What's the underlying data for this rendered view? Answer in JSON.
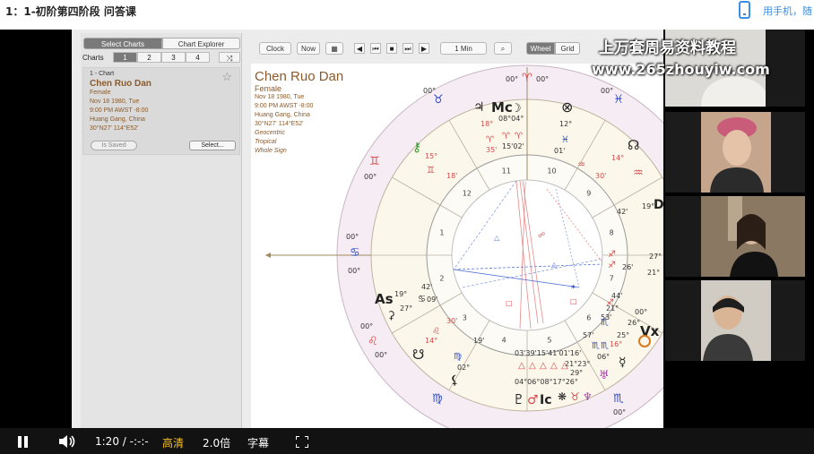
{
  "header": {
    "lesson_title": "1：1-初阶第四阶段 问答课",
    "phone_link": "用手机，随"
  },
  "watermark": {
    "line1": "上万套周易资料教程",
    "line2": "www.265zhouyiw.com"
  },
  "sidebar": {
    "seg_select": "Select Charts",
    "seg_explorer": "Chart Explorer",
    "charts_label": "Charts",
    "chart_tabs": [
      "1",
      "2",
      "3",
      "4"
    ],
    "card": {
      "number": "1 - Chart",
      "name": "Chen Ruo Dan",
      "gender": "Female",
      "date": "Nov 18 1980, Tue",
      "time": "9:00 PM AWST -8:00",
      "place": "Huang Gang, China",
      "coords": "30°N27' 114°E52'",
      "saved_label": "Is Saved",
      "select_label": "Select..."
    }
  },
  "toolbar": {
    "clock": "Clock",
    "now": "Now",
    "interval": "1 Min",
    "wheel": "Wheel",
    "grid": "Grid"
  },
  "chart_info": {
    "name": "Chen Ruo Dan",
    "gender": "Female",
    "date": "Nov 18 1980, Tue",
    "time": "9:00 PM AWST -8:00",
    "place": "Huang Gang, China",
    "coords": "30°N27' 114°E52'",
    "geo": "Geocentric",
    "zodiac": "Tropical",
    "house": "Whole Sign"
  },
  "wheel": {
    "house_numbers": [
      "1",
      "2",
      "3",
      "4",
      "5",
      "6",
      "7",
      "8",
      "9",
      "10",
      "11",
      "12"
    ],
    "labels": {
      "asc": "As",
      "mc": "Mc",
      "ic": "Ic",
      "vx": "Vx"
    },
    "degree_texts": [
      "00°",
      "00°",
      "00°",
      "00°",
      "00°",
      "00°",
      "00°",
      "00°",
      "00°",
      "00°",
      "19°",
      "42'",
      "27°",
      "09'",
      "18°",
      "08°04°",
      "12°",
      "14°",
      "15°",
      "18'",
      "35'",
      "15'02'",
      "01'",
      "30'",
      "42'",
      "19°",
      "27°",
      "26'",
      "21°",
      "44'",
      "21°",
      "53'",
      "00°",
      "26°",
      "25°",
      "16°",
      "57'",
      "06°",
      "03'39'15'41'01'16'",
      "21°23°",
      "04°06°08°17°26°",
      "19'",
      "02°",
      "14°",
      "30'",
      "29°"
    ]
  },
  "player": {
    "time": "1:20 / -:-:-",
    "quality": "高清",
    "speed": "2.0倍",
    "subtitles": "字幕"
  }
}
